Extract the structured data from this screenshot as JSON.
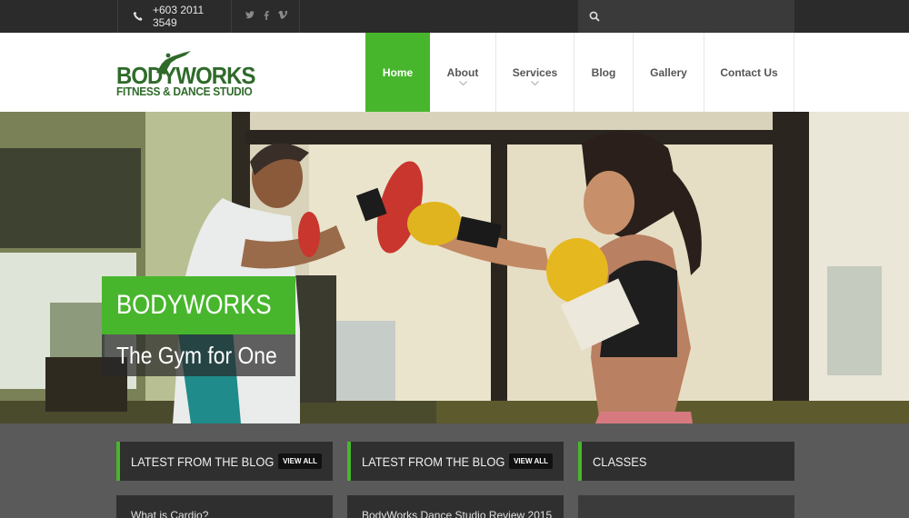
{
  "topbar": {
    "phone": "+603 2011 3549",
    "social": [
      "twitter-icon",
      "facebook-icon",
      "vimeo-icon"
    ],
    "search_placeholder": ""
  },
  "logo": {
    "line1": "BODYWORKS",
    "line2": "FITNESS & DANCE STUDIO"
  },
  "nav": {
    "items": [
      {
        "label": "Home",
        "active": true,
        "has_submenu": false
      },
      {
        "label": "About",
        "active": false,
        "has_submenu": true
      },
      {
        "label": "Services",
        "active": false,
        "has_submenu": true
      },
      {
        "label": "Blog",
        "active": false,
        "has_submenu": false
      },
      {
        "label": "Gallery",
        "active": false,
        "has_submenu": false
      },
      {
        "label": "Contact Us",
        "active": false,
        "has_submenu": false
      }
    ]
  },
  "hero": {
    "title": "BODYWORKS",
    "subtitle": "The Gym for One"
  },
  "widgets": [
    {
      "title": "LATEST FROM THE BLOG",
      "button": "VIEW ALL",
      "post": "What is Cardio?"
    },
    {
      "title": "LATEST FROM THE BLOG",
      "button": "VIEW ALL",
      "post": "BodyWorks Dance Studio Review 2015"
    },
    {
      "title": "CLASSES",
      "post": ""
    }
  ],
  "colors": {
    "accent": "#48b62d",
    "topbar": "#2b2b2b",
    "panel": "#2f2f2f",
    "logo": "#2f6a2a"
  }
}
